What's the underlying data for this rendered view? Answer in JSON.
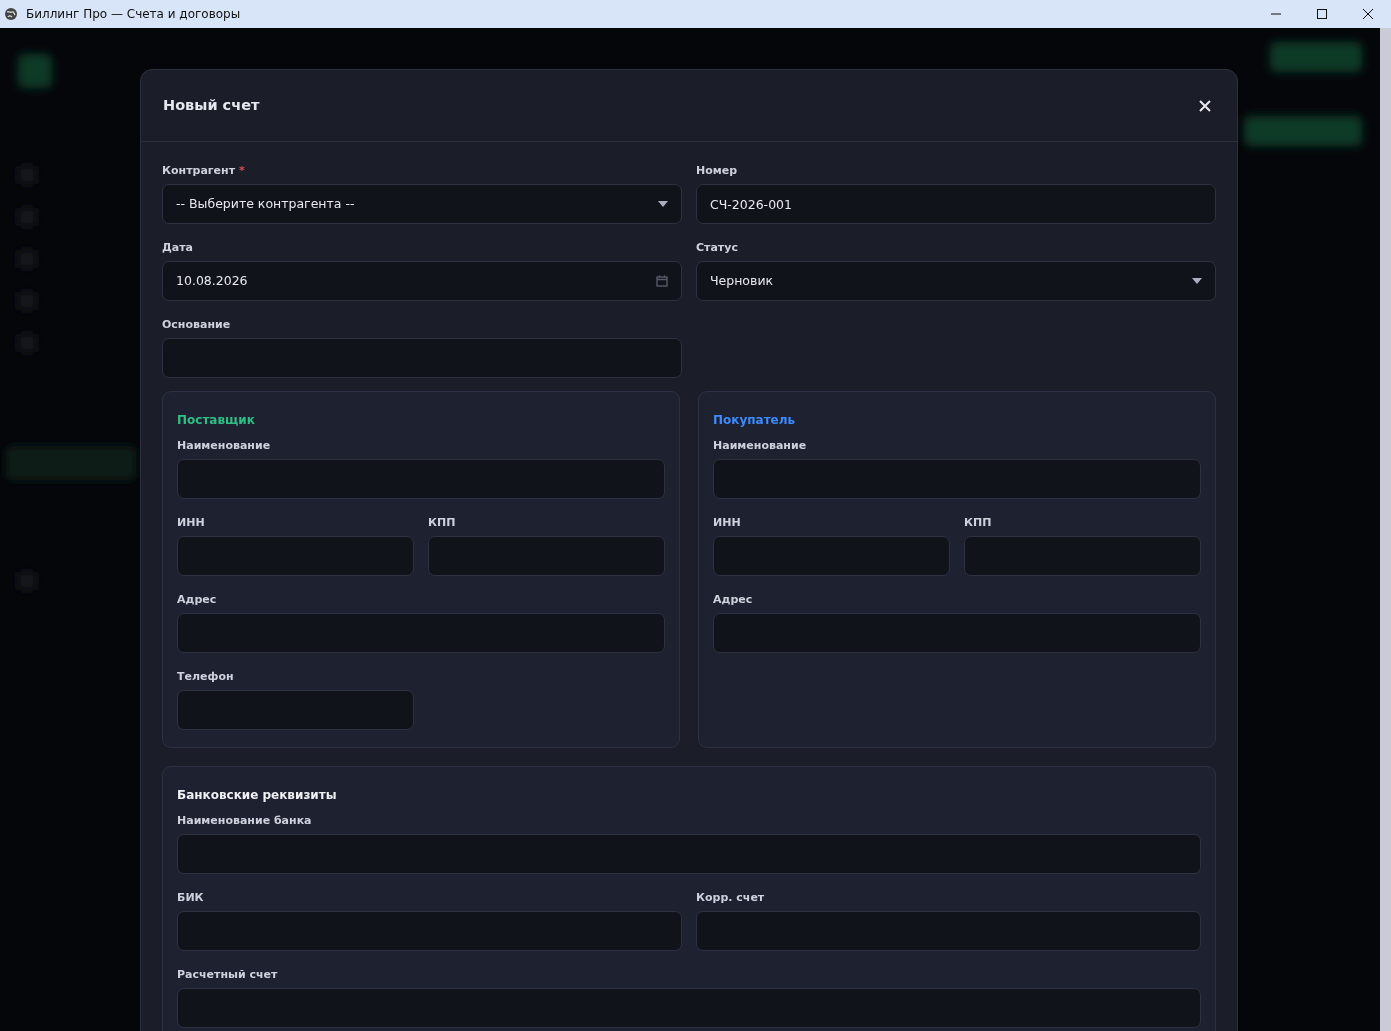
{
  "window": {
    "title": "Биллинг Про — Счета и договоры"
  },
  "dialog": {
    "title": "Новый счет",
    "fields": [
      {
        "label": "Контрагент",
        "required_mark": "*",
        "kind": "select",
        "value": "-- Выберите контрагента --"
      },
      {
        "label": "Номер",
        "kind": "text",
        "value": "СЧ-2026-001"
      },
      {
        "label": "Дата",
        "kind": "date",
        "value": "10.08.2026"
      },
      {
        "label": "Статус",
        "kind": "select",
        "value": "Черновик"
      },
      {
        "label": "Основание",
        "kind": "text"
      }
    ],
    "parties": [
      {
        "title": "Поставщик",
        "color": "#2fbf85",
        "rows": [
          [
            {
              "label": "Наименование",
              "kind": "wide"
            }
          ],
          [
            {
              "label": "ИНН",
              "kind": "short"
            },
            {
              "label": "КПП",
              "kind": "short"
            }
          ],
          [
            {
              "label": "Адрес",
              "kind": "wide"
            }
          ],
          [
            {
              "label": "Телефон",
              "kind": "short"
            }
          ]
        ]
      },
      {
        "title": "Покупатель",
        "color": "#3d8bfd",
        "rows": [
          [
            {
              "label": "Наименование",
              "kind": "wide"
            }
          ],
          [
            {
              "label": "ИНН",
              "kind": "short"
            },
            {
              "label": "КПП",
              "kind": "short"
            }
          ],
          [
            {
              "label": "Адрес",
              "kind": "wide"
            }
          ]
        ]
      }
    ],
    "bank": {
      "title": "Банковские реквизиты",
      "rows": [
        [
          {
            "label": "Наименование банка",
            "kind": "wide"
          }
        ],
        [
          {
            "label": "БИК",
            "kind": "short"
          },
          {
            "label": "Корр. счет",
            "kind": "short"
          }
        ],
        [
          {
            "label": "Расчетный счет",
            "kind": "wide"
          }
        ]
      ]
    }
  }
}
